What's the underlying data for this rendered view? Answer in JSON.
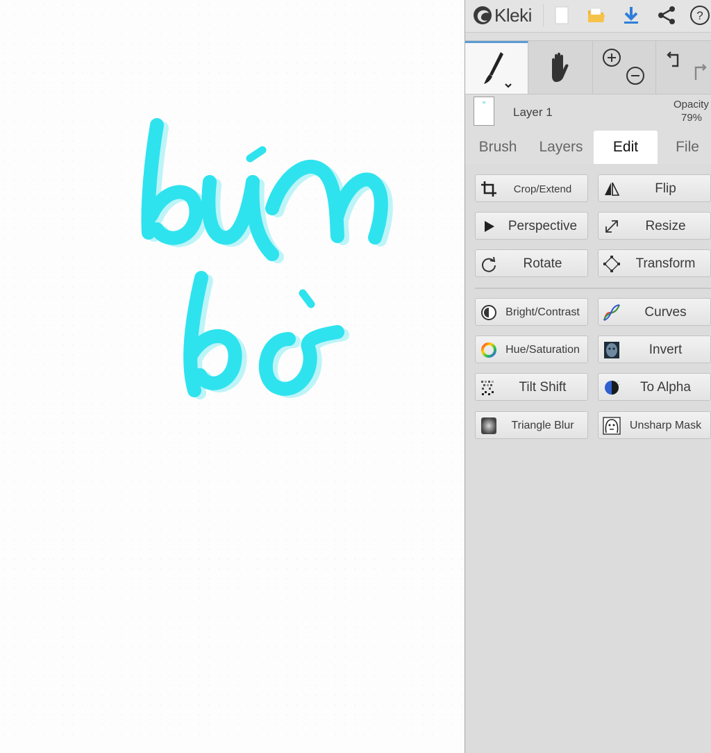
{
  "app": {
    "name": "Kleki"
  },
  "topbar": {
    "icons": [
      "new-image-icon",
      "open-folder-icon",
      "download-icon",
      "share-icon",
      "help-icon"
    ]
  },
  "tools": {
    "brush_icon": "brush-icon",
    "hand_icon": "hand-icon",
    "zoom_in_icon": "zoom-in-icon",
    "zoom_out_icon": "zoom-out-icon",
    "undo_icon": "undo-icon",
    "redo_icon": "redo-icon"
  },
  "layer": {
    "name": "Layer 1",
    "opacity_label": "Opacity",
    "opacity_value": "79%"
  },
  "tabs": [
    {
      "label": "Brush",
      "active": false
    },
    {
      "label": "Layers",
      "active": false
    },
    {
      "label": "Edit",
      "active": true
    },
    {
      "label": "File",
      "active": false
    }
  ],
  "edit_buttons": {
    "crop": "Crop/Extend",
    "flip": "Flip",
    "perspective": "Perspective",
    "resize": "Resize",
    "rotate": "Rotate",
    "transform": "Transform",
    "bright_contrast": "Bright/Contrast",
    "curves": "Curves",
    "hue_saturation": "Hue/Saturation",
    "invert": "Invert",
    "tilt_shift": "Tilt Shift",
    "to_alpha": "To Alpha",
    "triangle_blur": "Triangle Blur",
    "unsharp_mask": "Unsharp Mask"
  },
  "canvas": {
    "stroke_color": "#2ee6f0",
    "shadow_color": "#b8f4f8"
  },
  "colors": {
    "accent": "#2f7ed8",
    "folder": "#f3b631",
    "panel_bg": "#dedede"
  }
}
